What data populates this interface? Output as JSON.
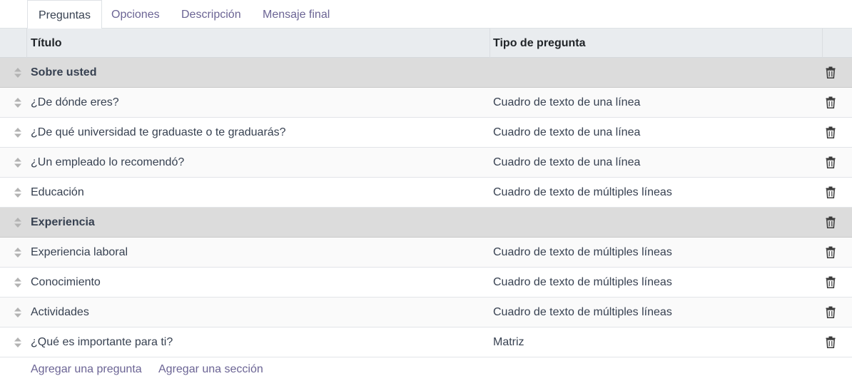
{
  "tabs": [
    {
      "label": "Preguntas",
      "active": true
    },
    {
      "label": "Opciones",
      "active": false
    },
    {
      "label": "Descripción",
      "active": false
    },
    {
      "label": "Mensaje final",
      "active": false
    }
  ],
  "columns": {
    "title": "Título",
    "type": "Tipo de pregunta"
  },
  "rows": [
    {
      "kind": "section",
      "title": "Sobre usted",
      "type": ""
    },
    {
      "kind": "question",
      "title": "¿De dónde eres?",
      "type": "Cuadro de texto de una línea"
    },
    {
      "kind": "question",
      "title": "¿De qué universidad te graduaste o te graduarás?",
      "type": "Cuadro de texto de una línea"
    },
    {
      "kind": "question",
      "title": "¿Un empleado lo recomendó?",
      "type": "Cuadro de texto de una línea"
    },
    {
      "kind": "question",
      "title": "Educación",
      "type": "Cuadro de texto de múltiples líneas"
    },
    {
      "kind": "section",
      "title": "Experiencia",
      "type": ""
    },
    {
      "kind": "question",
      "title": "Experiencia laboral",
      "type": "Cuadro de texto de múltiples líneas"
    },
    {
      "kind": "question",
      "title": "Conocimiento",
      "type": "Cuadro de texto de múltiples líneas"
    },
    {
      "kind": "question",
      "title": "Actividades",
      "type": "Cuadro de texto de múltiples líneas"
    },
    {
      "kind": "question",
      "title": "¿Qué es importante para ti?",
      "type": "Matriz"
    }
  ],
  "actions": {
    "add_question": "Agregar una pregunta",
    "add_section": "Agregar una sección"
  },
  "icons": {
    "handle": "sort-handle-icon",
    "delete": "trash-icon"
  },
  "colors": {
    "link": "#6b6494",
    "section_bg": "#dcdcdc",
    "header_bg": "#e9ecef"
  }
}
